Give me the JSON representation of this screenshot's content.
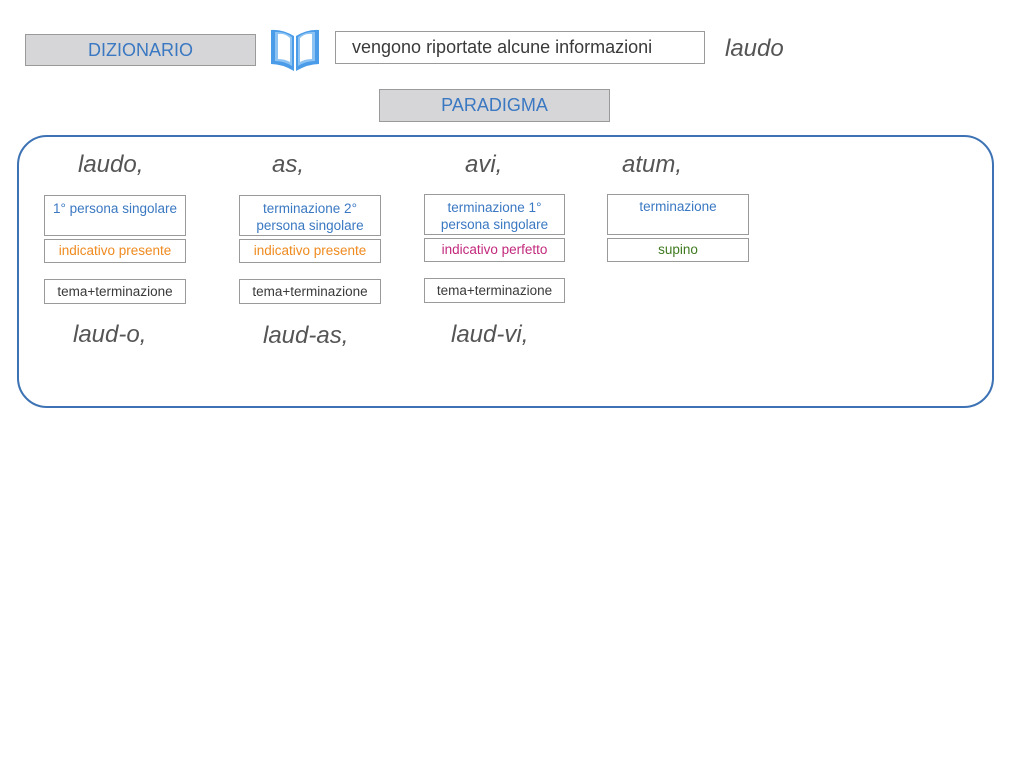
{
  "header": {
    "dizionario_label": "DIZIONARIO",
    "book_icon": "open-book-icon",
    "info_text": "vengono riportate alcune informazioni",
    "headword": "laudo",
    "paradigma_label": "PARADIGMA"
  },
  "paradigm": {
    "forms": [
      "laudo,",
      "as,",
      "avi,",
      "atum,"
    ],
    "descriptions": [
      {
        "line1": "1° persona singolare",
        "line2": ""
      },
      {
        "line1": "terminazione 2°",
        "line2": "persona singolare"
      },
      {
        "line1": "terminazione 1°",
        "line2": "persona singolare"
      },
      {
        "line1": "terminazione",
        "line2": ""
      }
    ],
    "grammar": [
      "indicativo presente",
      "indicativo presente",
      "indicativo perfetto",
      "supino"
    ],
    "structure": [
      "tema+terminazione",
      "tema+terminazione",
      "tema+terminazione"
    ],
    "split_forms": [
      "laud-o,",
      "laud-as,",
      "laud-vi,"
    ]
  },
  "colors": {
    "accent_blue": "#3a78c2",
    "frame_blue": "#3d73b5",
    "orange": "#ef8a1f",
    "magenta": "#c2297d",
    "green": "#3f7a20"
  }
}
